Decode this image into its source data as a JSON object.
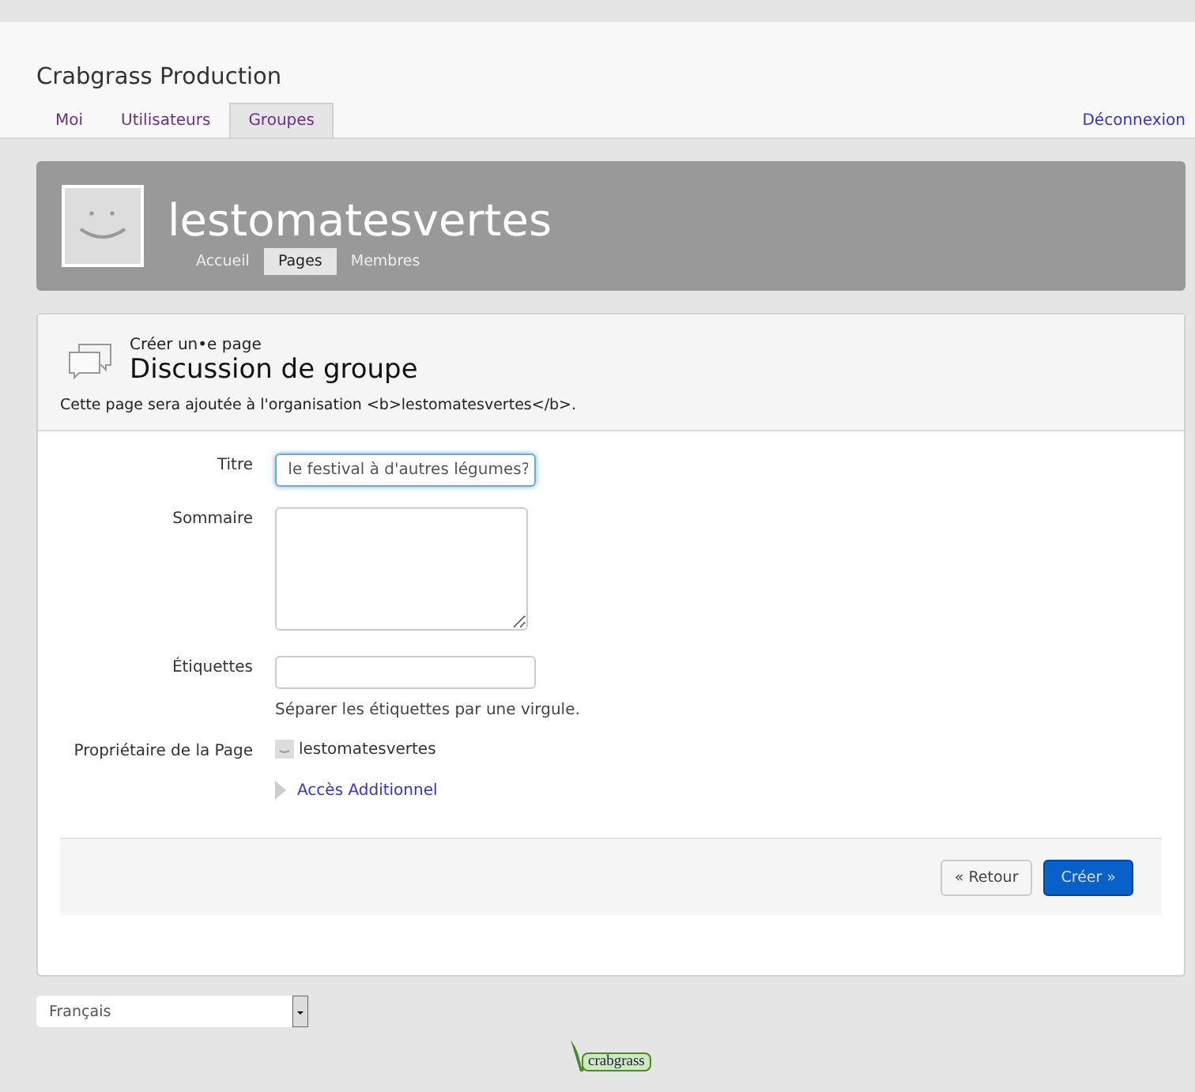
{
  "site_title": "Crabgrass Production",
  "nav_tabs": [
    {
      "label": "Moi",
      "selected": false
    },
    {
      "label": "Utilisateurs",
      "selected": false
    },
    {
      "label": "Groupes",
      "selected": true
    }
  ],
  "logout": "Déconnexion",
  "group": {
    "name": "lestomatesvertes",
    "tabs": [
      {
        "label": "Accueil",
        "selected": false
      },
      {
        "label": "Pages",
        "selected": true
      },
      {
        "label": "Membres",
        "selected": false
      }
    ]
  },
  "page_header": {
    "subtitle": "Créer un•e page",
    "title": "Discussion de groupe",
    "note": "Cette page sera ajoutée à l'organisation <b>lestomatesvertes</b>."
  },
  "form": {
    "fields": [
      {
        "kind": "text",
        "label": "Titre",
        "value": " le festival à d'autres légumes?",
        "focused": true
      },
      {
        "kind": "textarea",
        "label": "Sommaire"
      },
      {
        "kind": "text",
        "label": "Étiquettes",
        "focused": false,
        "hint": "Séparer les étiquettes par une virgule."
      },
      {
        "kind": "owner",
        "label": "Propriétaire de la Page",
        "value": "lestomatesvertes"
      }
    ],
    "more_link": "Accès Additionnel",
    "buttons": [
      {
        "label": "« Retour",
        "kind": "secondary"
      },
      {
        "label": "Créer »",
        "kind": "primary"
      }
    ]
  },
  "language": "Français",
  "logo_text": "crabgrass"
}
